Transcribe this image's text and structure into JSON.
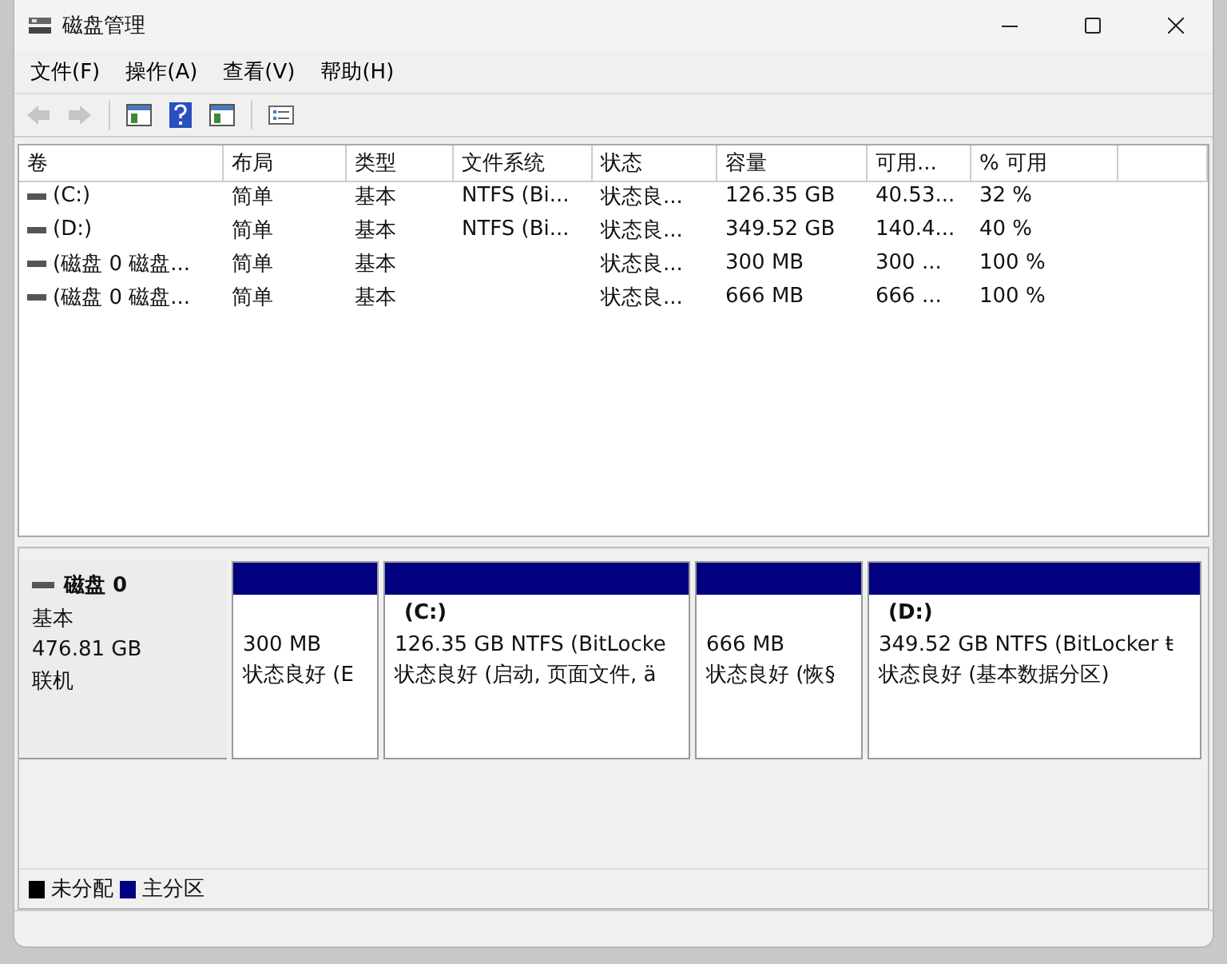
{
  "window": {
    "title": "磁盘管理"
  },
  "menu": [
    "文件(F)",
    "操作(A)",
    "查看(V)",
    "帮助(H)"
  ],
  "toolbar": [
    {
      "kind": "back",
      "disabled": true
    },
    {
      "kind": "forward",
      "disabled": true
    },
    {
      "kind": "panel",
      "disabled": false
    },
    {
      "kind": "help",
      "disabled": false
    },
    {
      "kind": "panel",
      "disabled": false
    },
    {
      "kind": "properties",
      "disabled": false
    }
  ],
  "table": {
    "columns": [
      "卷",
      "布局",
      "类型",
      "文件系统",
      "状态",
      "容量",
      "可用...",
      "% 可用"
    ],
    "rows": [
      {
        "cells": [
          "(C:)",
          "简单",
          "基本",
          "NTFS (Bi...",
          "状态良...",
          "126.35 GB",
          "40.53...",
          "32 %"
        ]
      },
      {
        "cells": [
          "(D:)",
          "简单",
          "基本",
          "NTFS (Bi...",
          "状态良...",
          "349.52 GB",
          "140.4...",
          "40 %"
        ]
      },
      {
        "cells": [
          "(磁盘 0 磁盘...",
          "简单",
          "基本",
          "",
          "状态良...",
          "300 MB",
          "300 ...",
          "100 %"
        ]
      },
      {
        "cells": [
          "(磁盘 0 磁盘...",
          "简单",
          "基本",
          "",
          "状态良...",
          "666 MB",
          "666 ...",
          "100 %"
        ]
      }
    ]
  },
  "disk": {
    "name": "磁盘 0",
    "type": "基本",
    "size": "476.81 GB",
    "status": "联机",
    "partitions": [
      {
        "size": "300 MB",
        "status": "状态良好 (E",
        "color": "#000080"
      },
      {
        "label": "(C:)",
        "size": "126.35 GB NTFS (BitLocke",
        "status": "状态良好 (启动, 页面文件, ä",
        "color": "#000080"
      },
      {
        "size": "666 MB",
        "status": "状态良好 (恢§",
        "color": "#000080"
      },
      {
        "label": "(D:)",
        "size": "349.52 GB NTFS (BitLocker ŧ",
        "status": "状态良好 (基本数据分区)",
        "color": "#000080"
      }
    ]
  },
  "legend": [
    {
      "label": "未分配",
      "color": "#000000"
    },
    {
      "label": "主分区",
      "color": "#000080"
    }
  ]
}
